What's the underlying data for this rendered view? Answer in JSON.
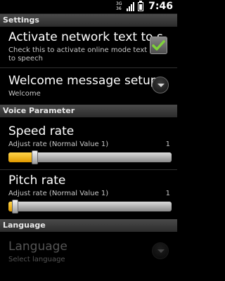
{
  "status_bar": {
    "network_top": "3G",
    "network_bottom": "36",
    "time": "7:46"
  },
  "sections": {
    "settings": "Settings",
    "voice_parameter": "Voice Parameter",
    "language": "Language"
  },
  "prefs": {
    "network_text": {
      "title": "Activate network text to s",
      "summary_line1": "Check this to activate online mode text",
      "summary_line2": "to speech",
      "checked": true
    },
    "welcome": {
      "title": "Welcome message setup",
      "summary": "Welcome"
    },
    "speed": {
      "title": "Speed rate",
      "summary": "Adjust rate (Normal Value 1)",
      "value": "1",
      "level": 0.16
    },
    "pitch": {
      "title": "Pitch rate",
      "summary": "Adjust rate (Normal Value 1)",
      "value": "1",
      "level": 0.04
    },
    "language": {
      "title": "Language",
      "summary": "Select language",
      "enabled": false
    }
  },
  "colors": {
    "accent": "#f5b800",
    "checkmark": "#7fd33a"
  }
}
